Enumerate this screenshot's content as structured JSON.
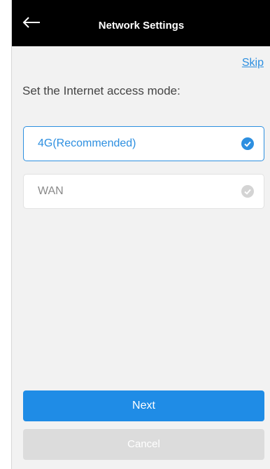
{
  "header": {
    "title": "Network Settings",
    "back_icon": "arrow-left-icon"
  },
  "skip_link": "Skip",
  "prompt": "Set the Internet access mode:",
  "options": [
    {
      "label": "4G(Recommended)",
      "selected": true,
      "icon": "check-circle-icon"
    },
    {
      "label": "WAN",
      "selected": false,
      "icon": "check-circle-icon"
    }
  ],
  "buttons": {
    "next": "Next",
    "cancel": "Cancel"
  },
  "colors": {
    "accent": "#2d8fe0",
    "primary_button": "#1f8ce6",
    "disabled_button": "#dcdcdc",
    "header_bg": "#000000",
    "page_bg": "#f2f2f2"
  }
}
